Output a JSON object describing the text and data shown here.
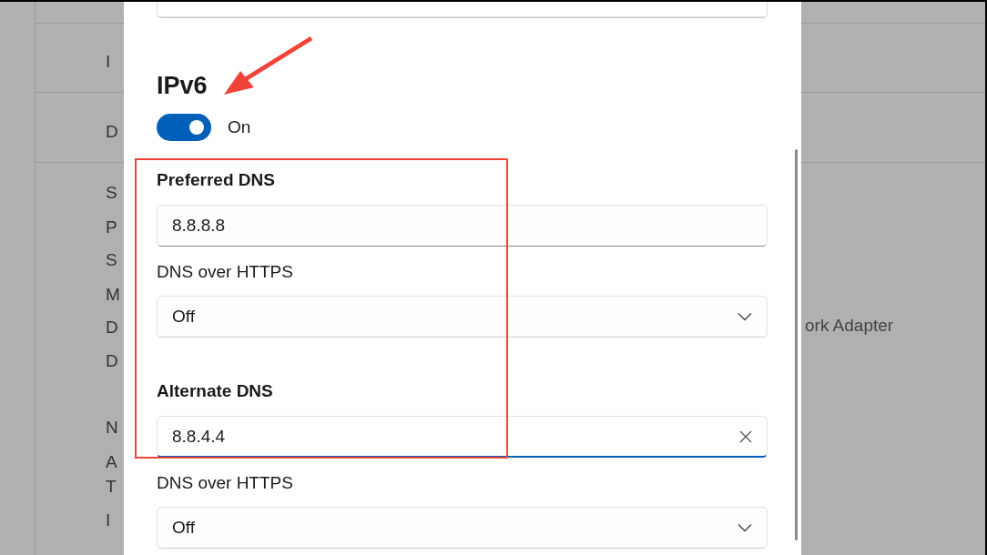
{
  "background": {
    "labels": [
      {
        "text": "I"
      },
      {
        "text": "D"
      },
      {
        "text": "S"
      },
      {
        "text": "P"
      },
      {
        "text": "S"
      },
      {
        "text": "M"
      },
      {
        "text": "D"
      },
      {
        "text": "D"
      },
      {
        "text": "N"
      },
      {
        "text": "A"
      },
      {
        "text": "T"
      },
      {
        "text": "I"
      }
    ],
    "right_text": "ork Adapter"
  },
  "ipv6": {
    "title": "IPv6",
    "toggle": {
      "on": true,
      "label": "On"
    }
  },
  "dns": [
    {
      "label": "Preferred DNS",
      "value": "8.8.8.8",
      "focused": false,
      "https_label": "DNS over HTTPS",
      "https_value": "Off"
    },
    {
      "label": "Alternate DNS",
      "value": "8.8.4.4",
      "focused": true,
      "https_label": "DNS over HTTPS",
      "https_value": "Off"
    }
  ]
}
